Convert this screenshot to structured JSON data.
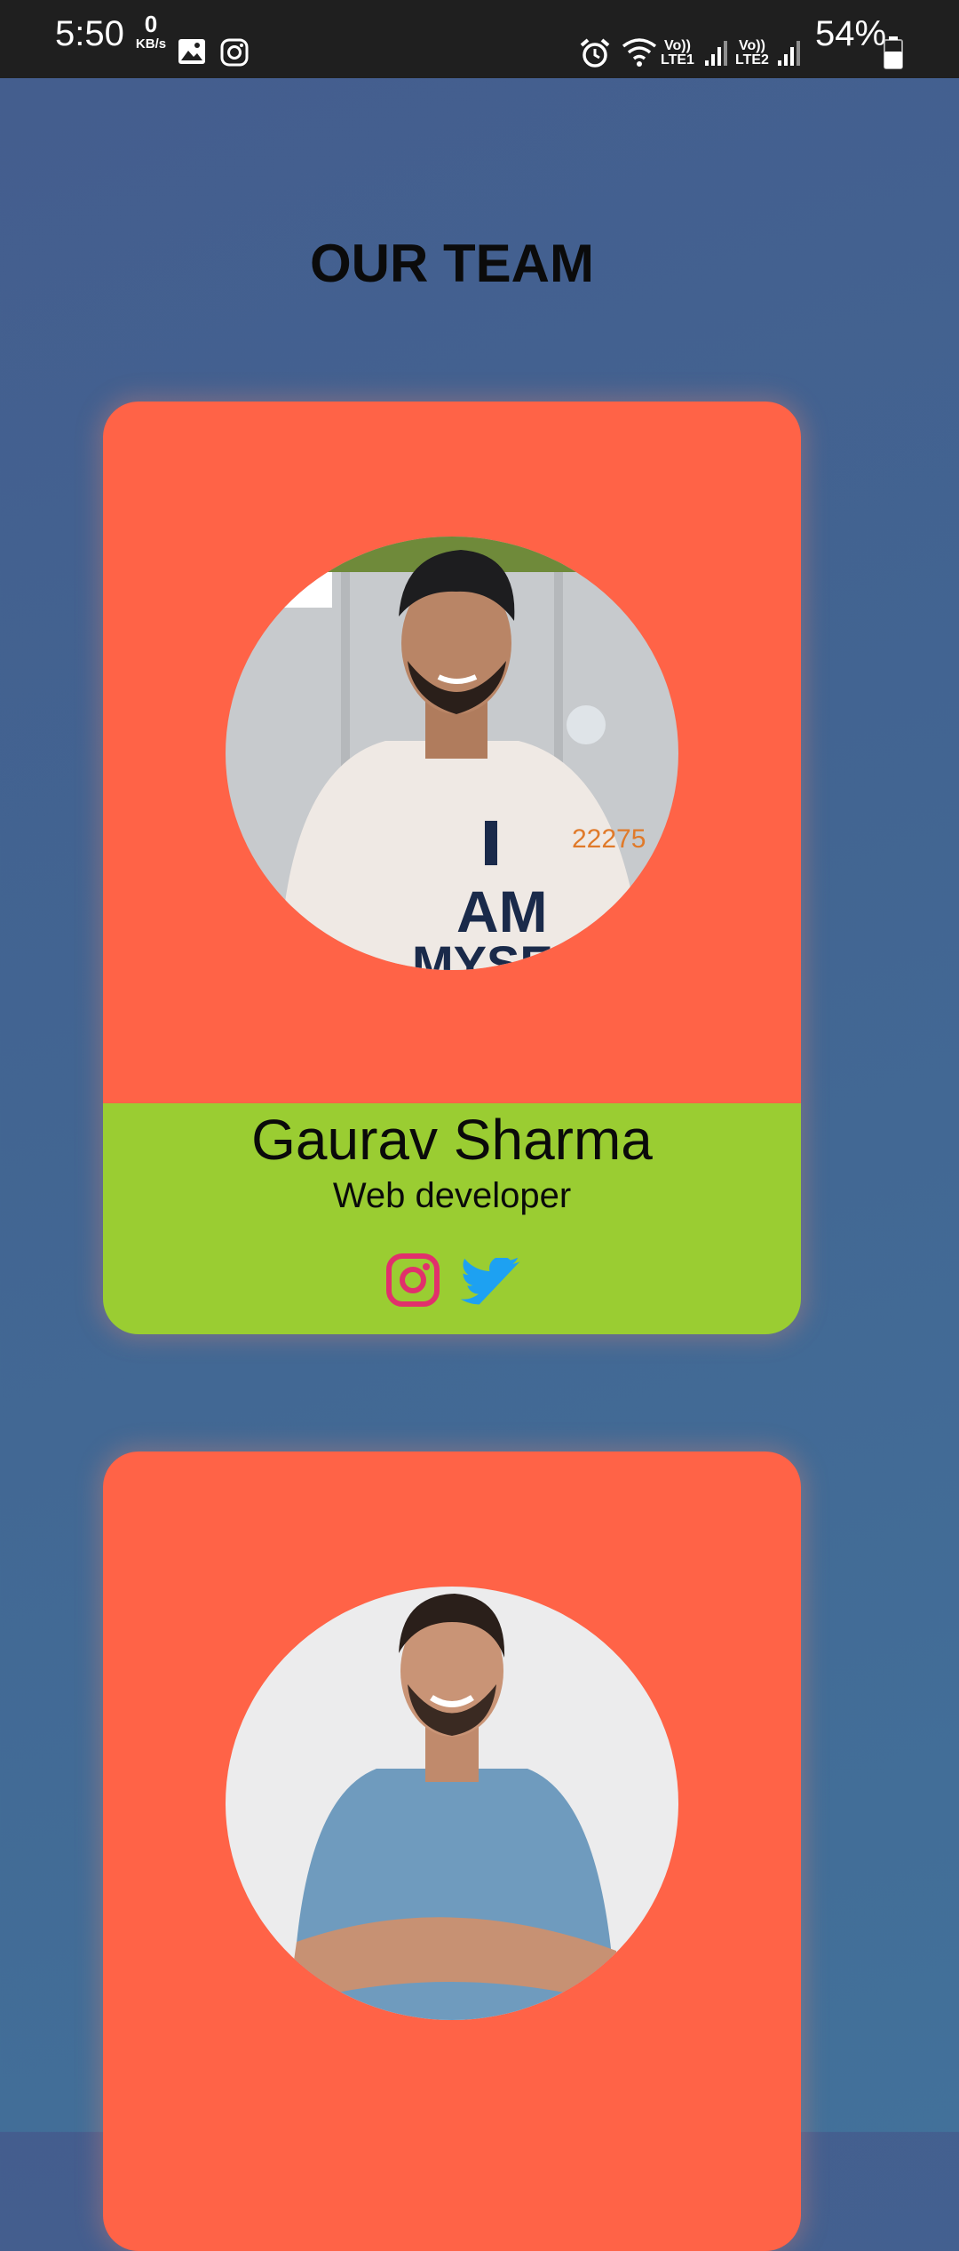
{
  "status_bar": {
    "time": "5:50",
    "net_speed_value": "0",
    "net_speed_unit": "KB/s",
    "sim1": "LTE1",
    "sim2": "LTE2",
    "volte": "Vo))",
    "battery": "54%",
    "icons": [
      "gallery-icon",
      "instagram-icon",
      "alarm-icon",
      "wifi-icon",
      "signal-icon",
      "battery-icon"
    ]
  },
  "page": {
    "title": "OUR TEAM"
  },
  "team": [
    {
      "name": "Gaurav Sharma",
      "role": "Web developer",
      "social": [
        "instagram",
        "twitter"
      ]
    },
    {
      "name": "",
      "role": ""
    }
  ],
  "colors": {
    "card_top": "#ff6347",
    "card_bottom": "#9acd32",
    "instagram": "#e1306c",
    "twitter": "#1da1f2"
  }
}
